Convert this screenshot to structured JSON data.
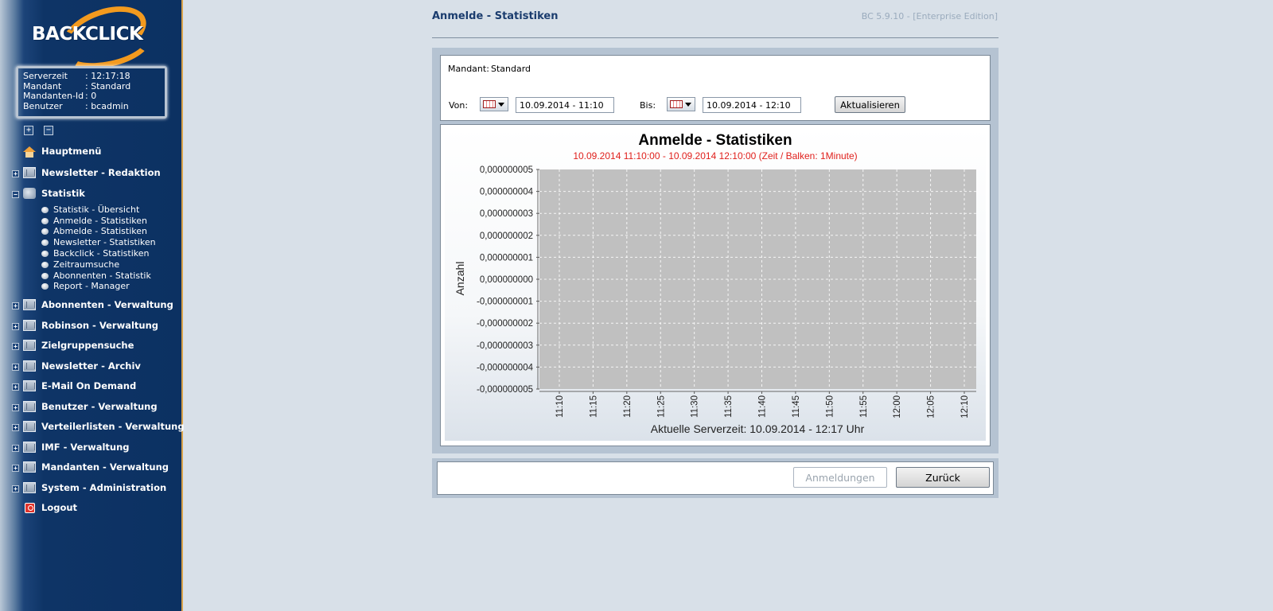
{
  "sidebar": {
    "logo_text": "BACKCLICK",
    "info": [
      {
        "key": "Serverzeit",
        "value": ": 12:17:18"
      },
      {
        "key": "Mandant",
        "value": ": Standard"
      },
      {
        "key": "Mandanten-Id",
        "value": ": 0"
      },
      {
        "key": "Benutzer",
        "value": ": bcadmin"
      }
    ],
    "expand_all": "+",
    "collapse_all": "−",
    "menu": {
      "home": "Hauptmenü",
      "newsletter_redaktion": "Newsletter - Redaktion",
      "statistik": "Statistik",
      "statistik_sub": [
        "Statistik - Übersicht",
        "Anmelde - Statistiken",
        "Abmelde - Statistiken",
        "Newsletter - Statistiken",
        "Backclick - Statistiken",
        "Zeitraumsuche",
        "Abonnenten - Statistik",
        "Report - Manager"
      ],
      "abonnenten": "Abonnenten - Verwaltung",
      "robinson": "Robinson - Verwaltung",
      "zielgruppen": "Zielgruppensuche",
      "archiv": "Newsletter - Archiv",
      "email_on_demand": "E-Mail On Demand",
      "benutzer": "Benutzer - Verwaltung",
      "verteilerlisten": "Verteilerlisten - Verwaltung",
      "imf": "IMF - Verwaltung",
      "mandanten": "Mandanten - Verwaltung",
      "system": "System - Administration",
      "logout": "Logout"
    }
  },
  "header": {
    "title": "Anmelde - Statistiken",
    "version": "BC 5.9.10 - [Enterprise Edition]"
  },
  "filter": {
    "mandant_label": "Mandant:",
    "mandant_value": "Standard",
    "from_label": "Von:",
    "from_value": "10.09.2014 - 11:10",
    "to_label": "Bis:",
    "to_value": "10.09.2014 - 12:10",
    "refresh_label": "Aktualisieren"
  },
  "chart_data": {
    "type": "bar",
    "title": "Anmelde - Statistiken",
    "subtitle": "10.09.2014 11:10:00 - 10.09.2014 12:10:00  (Zeit / Balken: 1Minute)",
    "ylabel": "Anzahl",
    "xlabel": "Aktuelle Serverzeit: 10.09.2014 - 12:17 Uhr",
    "ylim": [
      -5e-09,
      5e-09
    ],
    "y_ticks": [
      "0,000000005",
      "0,000000004",
      "0,000000003",
      "0,000000002",
      "0,000000001",
      "0,000000000",
      "-0,000000001",
      "-0,000000002",
      "-0,000000003",
      "-0,000000004",
      "-0,000000005"
    ],
    "categories": [
      "11:10",
      "11:15",
      "11:20",
      "11:25",
      "11:30",
      "11:35",
      "11:40",
      "11:45",
      "11:50",
      "11:55",
      "12:00",
      "12:05",
      "12:10"
    ],
    "values": [],
    "grid": true,
    "subtitle_color": "#e0201c",
    "plot_color": "#c0c0c0"
  },
  "buttons": {
    "anmeldungen": "Anmeldungen",
    "zurueck": "Zurück"
  }
}
